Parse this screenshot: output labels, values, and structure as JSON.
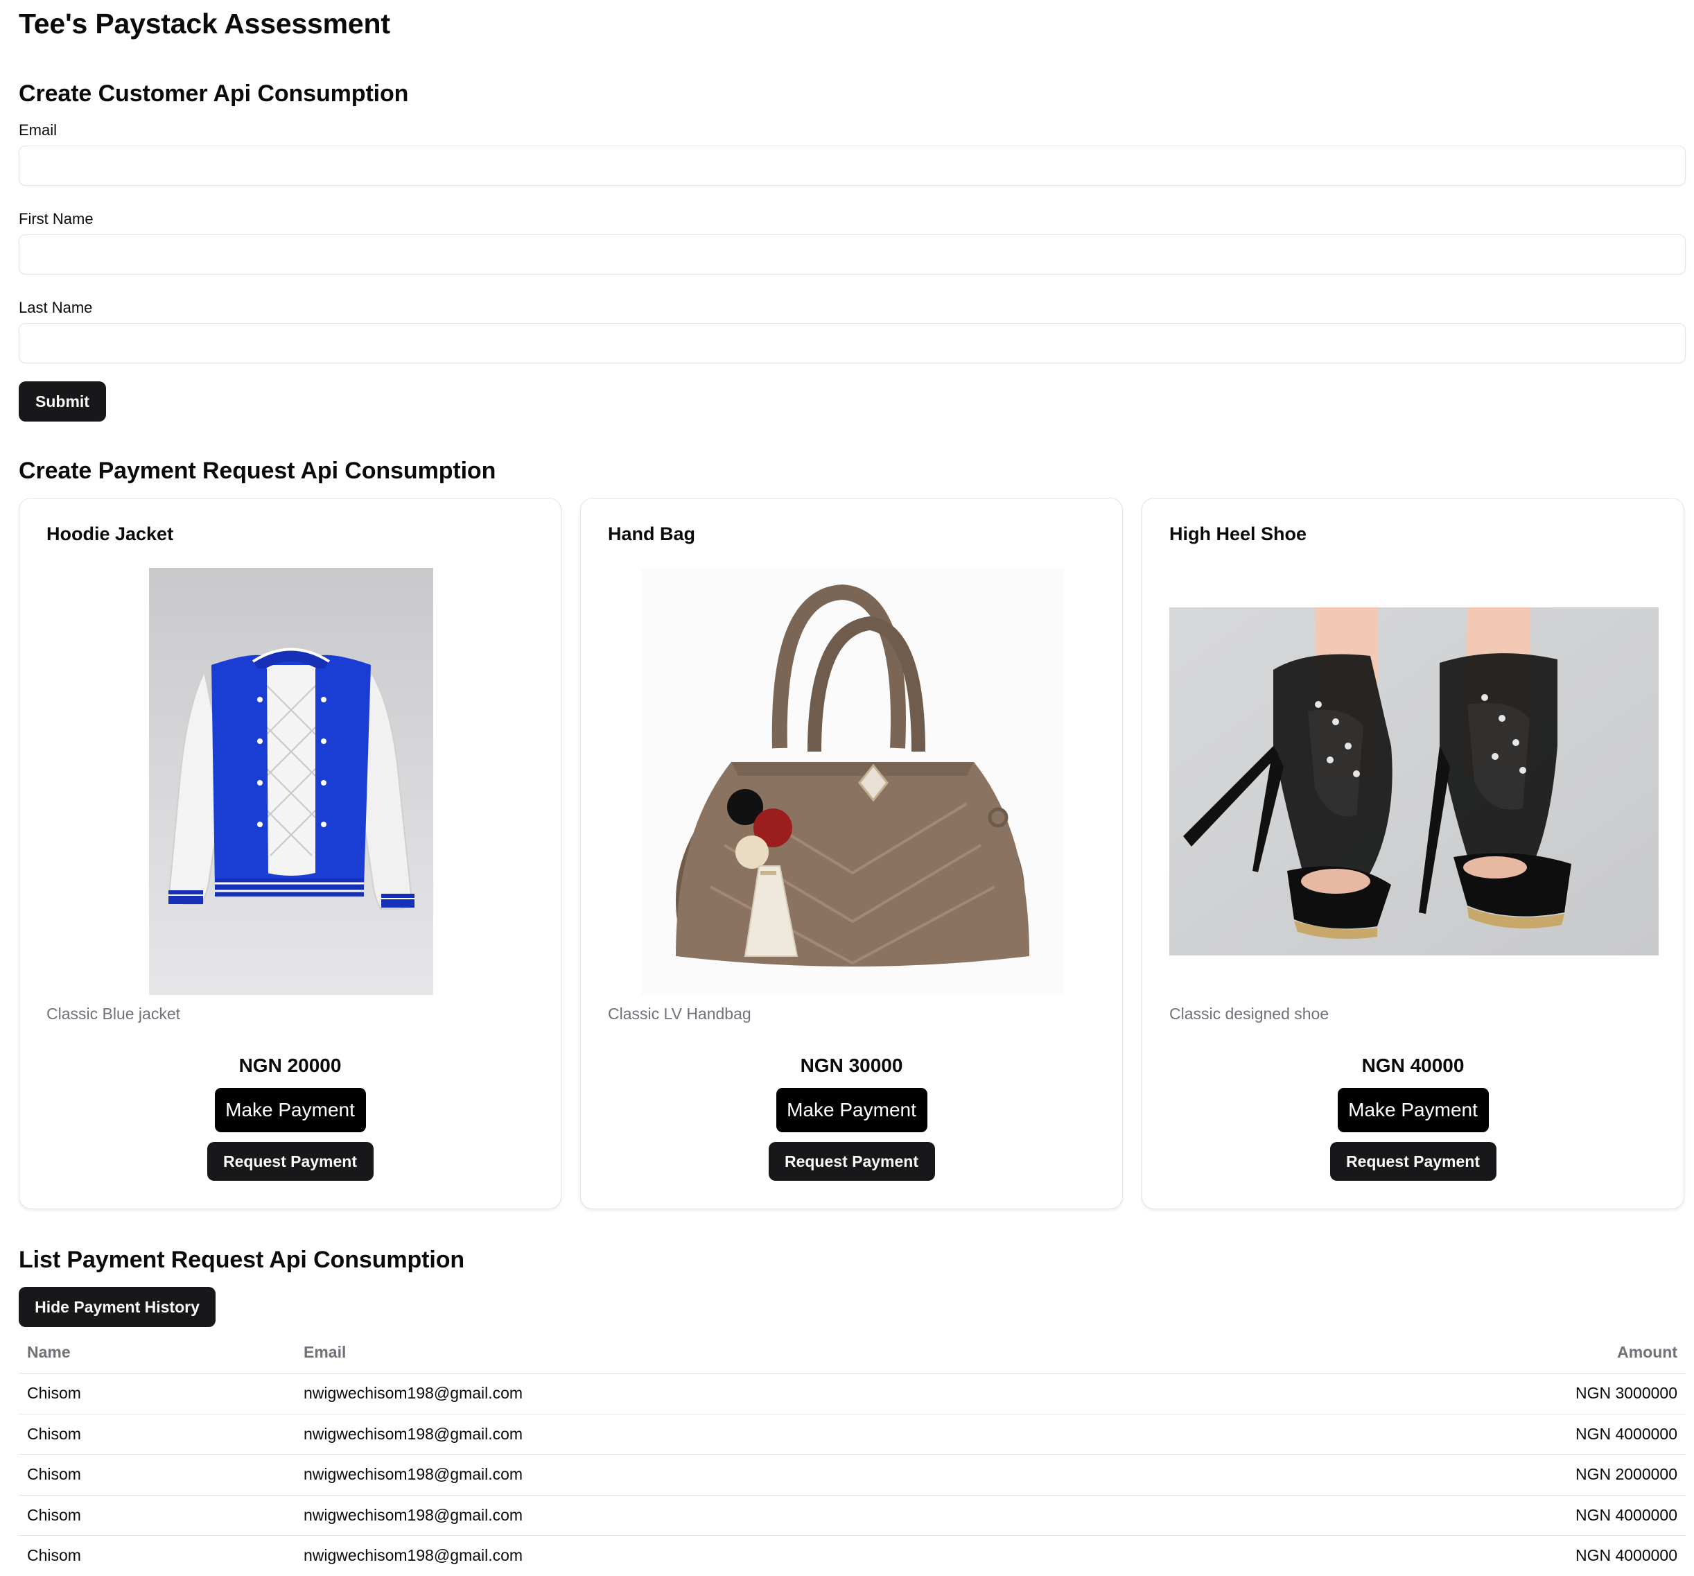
{
  "app_title": "Tee's Paystack Assessment",
  "create_customer": {
    "title": "Create Customer Api Consumption",
    "fields": [
      {
        "label": "Email",
        "value": "",
        "placeholder": ""
      },
      {
        "label": "First Name",
        "value": "",
        "placeholder": ""
      },
      {
        "label": "Last Name",
        "value": "",
        "placeholder": ""
      }
    ],
    "submit_label": "Submit"
  },
  "payment_request": {
    "title": "Create Payment Request Api Consumption",
    "products": [
      {
        "name": "Hoodie Jacket",
        "image": "jacket-image",
        "description": "Classic Blue jacket",
        "price": "NGN 20000",
        "make_payment_label": "Make Payment",
        "request_payment_label": "Request Payment"
      },
      {
        "name": "Hand Bag",
        "image": "handbag-image",
        "description": "Classic LV Handbag",
        "price": "NGN 30000",
        "make_payment_label": "Make Payment",
        "request_payment_label": "Request Payment"
      },
      {
        "name": "High Heel Shoe",
        "image": "high-heel-image",
        "description": "Classic designed shoe",
        "price": "NGN 40000",
        "make_payment_label": "Make Payment",
        "request_payment_label": "Request Payment"
      }
    ]
  },
  "list_requests": {
    "title": "List Payment Request Api Consumption",
    "toggle_label": "Hide Payment History",
    "columns": [
      "Name",
      "Email",
      "Amount"
    ],
    "rows": [
      [
        "Chisom",
        "nwigwechisom198@gmail.com",
        "NGN 3000000"
      ],
      [
        "Chisom",
        "nwigwechisom198@gmail.com",
        "NGN 4000000"
      ],
      [
        "Chisom",
        "nwigwechisom198@gmail.com",
        "NGN 2000000"
      ],
      [
        "Chisom",
        "nwigwechisom198@gmail.com",
        "NGN 4000000"
      ],
      [
        "Chisom",
        "nwigwechisom198@gmail.com",
        "NGN 4000000"
      ]
    ]
  },
  "colors": {
    "button_dark": "#18181b",
    "button_black": "#000000",
    "border": "#e4e4e7",
    "muted_text": "#71717a",
    "jacket_blue": "#1f3fd0",
    "bag_taupe": "#8a7461"
  }
}
